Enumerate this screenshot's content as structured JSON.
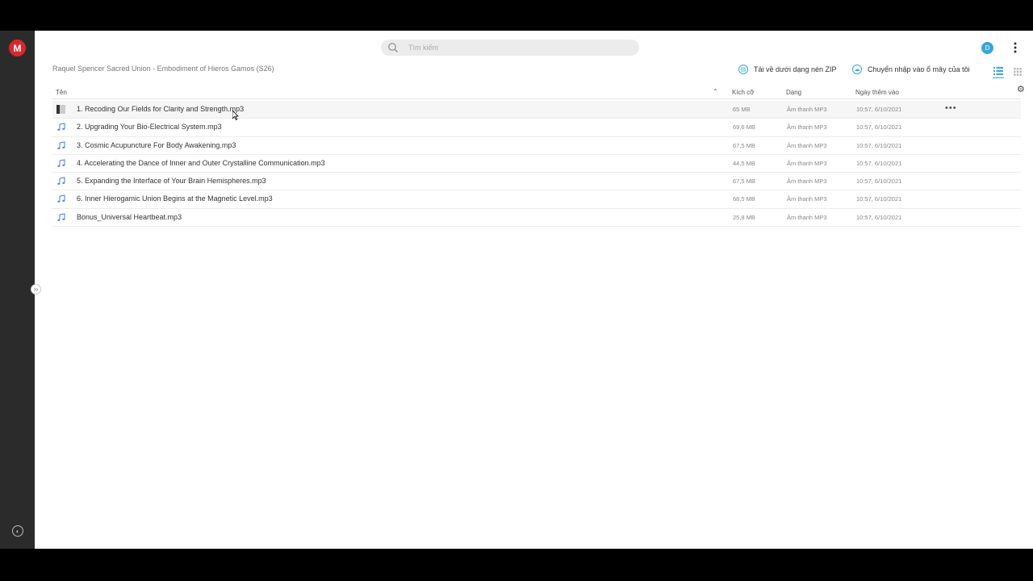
{
  "brand": {
    "logo_letter": "M",
    "accent": "#d9272e",
    "link_color": "#37a6d8"
  },
  "search": {
    "placeholder": "Tìm kiếm",
    "icon": "search-icon"
  },
  "user": {
    "avatar_letter": "D"
  },
  "breadcrumb": "Raquel Spencer Sacred Union - Embodiment of Hieros Gamos (S26)",
  "actions": {
    "download_zip": "Tải về dưới dạng nén ZIP",
    "import_cloud": "Chuyển nhập vào ổ mây của tôi"
  },
  "table": {
    "headers": {
      "name": "Tên",
      "size": "Kích cỡ",
      "type": "Dạng",
      "date": "Ngày thêm vào"
    },
    "rows": [
      {
        "name": "1. Recoding Our Fields for Clarity and Strength.mp3",
        "size": "65 MB",
        "type": "Âm thanh MP3",
        "date": "10:57, 6/10/2021"
      },
      {
        "name": "2. Upgrading Your Bio-Electrical System.mp3",
        "size": "69,6 MB",
        "type": "Âm thanh MP3",
        "date": "10:57, 6/10/2021"
      },
      {
        "name": "3. Cosmic Acupuncture For Body Awakening.mp3",
        "size": "67,5 MB",
        "type": "Âm thanh MP3",
        "date": "10:57, 6/10/2021"
      },
      {
        "name": "4. Accelerating the Dance of Inner and Outer Crystalline Communication.mp3",
        "size": "44,5 MB",
        "type": "Âm thanh MP3",
        "date": "10:57, 6/10/2021"
      },
      {
        "name": "5. Expanding the Interface of Your Brain Hemispheres.mp3",
        "size": "67,5 MB",
        "type": "Âm thanh MP3",
        "date": "10:57, 6/10/2021"
      },
      {
        "name": "6. Inner Hierogamic Union Begins at the Magnetic Level.mp3",
        "size": "68,5 MB",
        "type": "Âm thanh MP3",
        "date": "10:57, 6/10/2021"
      },
      {
        "name": "Bonus_Universal Heartbeat.mp3",
        "size": "25,8 MB",
        "type": "Âm thanh MP3",
        "date": "10:57, 6/10/2021"
      }
    ]
  }
}
